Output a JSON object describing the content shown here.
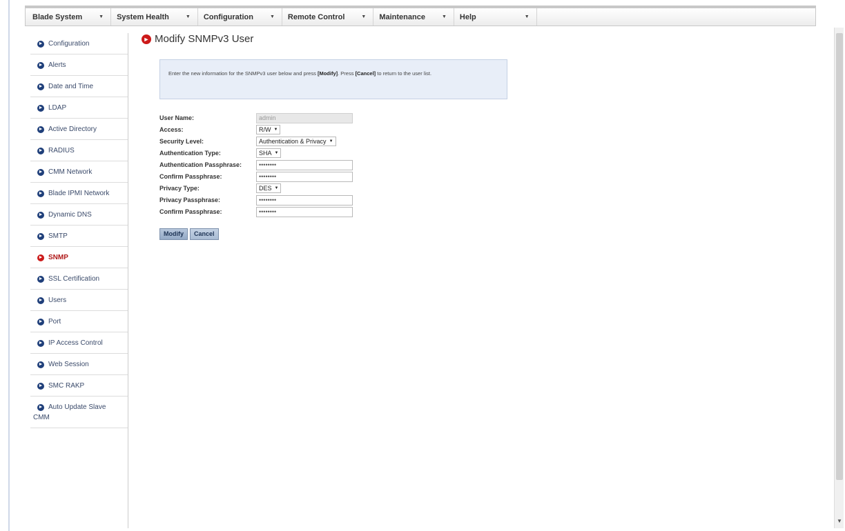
{
  "menu": {
    "items": [
      {
        "label": "Blade System"
      },
      {
        "label": "System Health"
      },
      {
        "label": "Configuration"
      },
      {
        "label": "Remote Control"
      },
      {
        "label": "Maintenance"
      },
      {
        "label": "Help"
      }
    ]
  },
  "sidebar": {
    "items": [
      {
        "label": "Configuration"
      },
      {
        "label": "Alerts"
      },
      {
        "label": "Date and Time"
      },
      {
        "label": "LDAP"
      },
      {
        "label": "Active Directory"
      },
      {
        "label": "RADIUS"
      },
      {
        "label": "CMM Network"
      },
      {
        "label": "Blade IPMI Network"
      },
      {
        "label": "Dynamic DNS"
      },
      {
        "label": "SMTP"
      },
      {
        "label": "SNMP",
        "active": true
      },
      {
        "label": "SSL Certification"
      },
      {
        "label": "Users"
      },
      {
        "label": "Port"
      },
      {
        "label": "IP Access Control"
      },
      {
        "label": "Web Session"
      },
      {
        "label": "SMC RAKP"
      },
      {
        "label": "Auto Update Slave",
        "label2": "CMM"
      }
    ]
  },
  "page": {
    "title": "Modify SNMPv3 User",
    "info_text_1": "Enter the new information for the SNMPv3 user below and press ",
    "info_modify": "[Modify]",
    "info_text_2": ". Press ",
    "info_cancel": "[Cancel]",
    "info_text_3": " to return to the user list."
  },
  "form": {
    "user_name": {
      "label": "User Name:",
      "value": "admin"
    },
    "access": {
      "label": "Access:",
      "value": "R/W"
    },
    "security_level": {
      "label": "Security Level:",
      "value": "Authentication & Privacy"
    },
    "auth_type": {
      "label": "Authentication Type:",
      "value": "SHA"
    },
    "auth_pass": {
      "label": "Authentication Passphrase:",
      "value": "••••••••"
    },
    "confirm_auth_pass": {
      "label": "Confirm Passphrase:",
      "value": "••••••••"
    },
    "privacy_type": {
      "label": "Privacy Type:",
      "value": "DES"
    },
    "privacy_pass": {
      "label": "Privacy Passphrase:",
      "value": "••••••••"
    },
    "confirm_privacy_pass": {
      "label": "Confirm Passphrase:",
      "value": "••••••••"
    }
  },
  "buttons": {
    "modify": "Modify",
    "cancel": "Cancel"
  }
}
